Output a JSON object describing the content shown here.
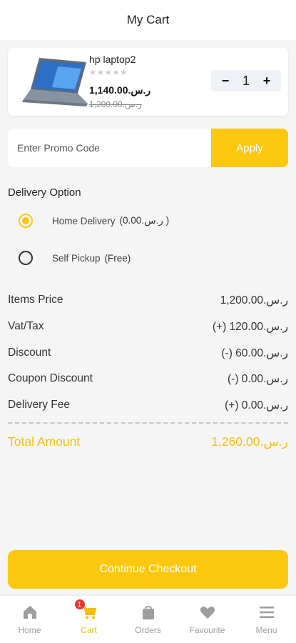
{
  "header": {
    "title": "My Cart"
  },
  "cart_item": {
    "name": "hp laptop2",
    "rating_stars": "★★★★★",
    "price": "1,140.00.ر.س",
    "old_price": "1,200.00.ر.س",
    "quantity": "1",
    "minus": "−",
    "plus": "+"
  },
  "promo": {
    "placeholder": "Enter Promo Code",
    "apply_label": "Apply"
  },
  "delivery": {
    "title": "Delivery Option",
    "options": [
      {
        "label": "Home Delivery",
        "sub": "(0.00.ر.س )",
        "selected": true
      },
      {
        "label": "Self Pickup",
        "sub": "(Free)",
        "selected": false
      }
    ]
  },
  "summary": {
    "rows": [
      {
        "label": "Items Price",
        "value": "1,200.00.ر.س"
      },
      {
        "label": "Vat/Tax",
        "value": "(+) 120.00.ر.س"
      },
      {
        "label": "Discount",
        "value": "(-) 60.00.ر.س"
      },
      {
        "label": "Coupon Discount",
        "value": "(-) 0.00.ر.س"
      },
      {
        "label": "Delivery Fee",
        "value": "(+) 0.00.ر.س"
      }
    ],
    "total_label": "Total Amount",
    "total_value": "1,260.00.ر.س"
  },
  "checkout_label": "Continue Checkout",
  "nav": {
    "items": [
      {
        "label": "Home",
        "icon": "home-icon"
      },
      {
        "label": "Cart",
        "icon": "cart-icon",
        "badge": "1"
      },
      {
        "label": "Orders",
        "icon": "bag-icon"
      },
      {
        "label": "Favourite",
        "icon": "heart-icon"
      },
      {
        "label": "Menu",
        "icon": "menu-icon"
      }
    ],
    "active": "Cart"
  },
  "colors": {
    "accent": "#fcc80f",
    "badge": "#e53935",
    "inactive": "#9e9e9e"
  }
}
